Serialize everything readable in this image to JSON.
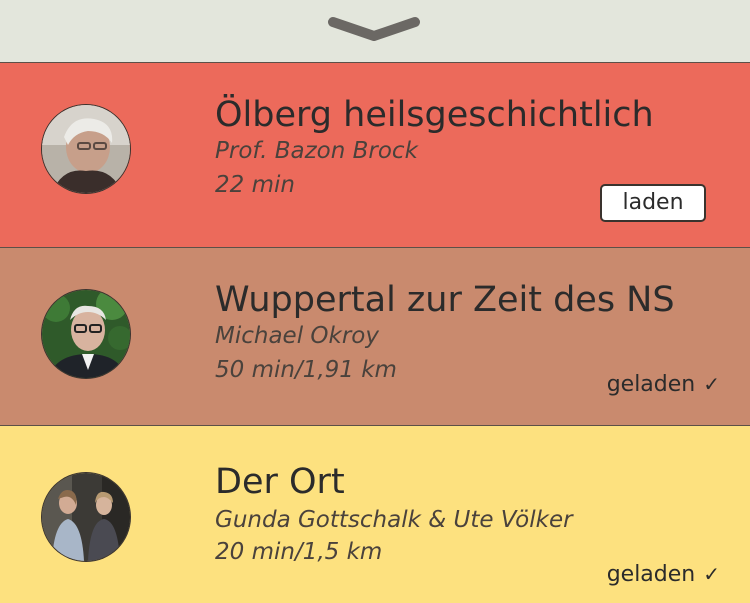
{
  "header": {
    "collapse_icon": "chevron-down-icon"
  },
  "tours": [
    {
      "title": "Ölberg heilsgeschichtlich",
      "author": "Prof. Bazon Brock",
      "meta": "22 min",
      "action_label": "laden",
      "state": "not-loaded",
      "color": "#ec6a5b"
    },
    {
      "title": "Wuppertal zur Zeit des NS",
      "author": "Michael Okroy",
      "meta": "50 min/1,91 km",
      "status_label": "geladen",
      "check": "✓",
      "state": "loaded",
      "color": "#c98a6e"
    },
    {
      "title": "Der Ort",
      "author": "Gunda Gottschalk & Ute Völker",
      "meta": "20 min/1,5 km",
      "status_label": "geladen",
      "check": "✓",
      "state": "loaded",
      "color": "#fde17f"
    }
  ]
}
